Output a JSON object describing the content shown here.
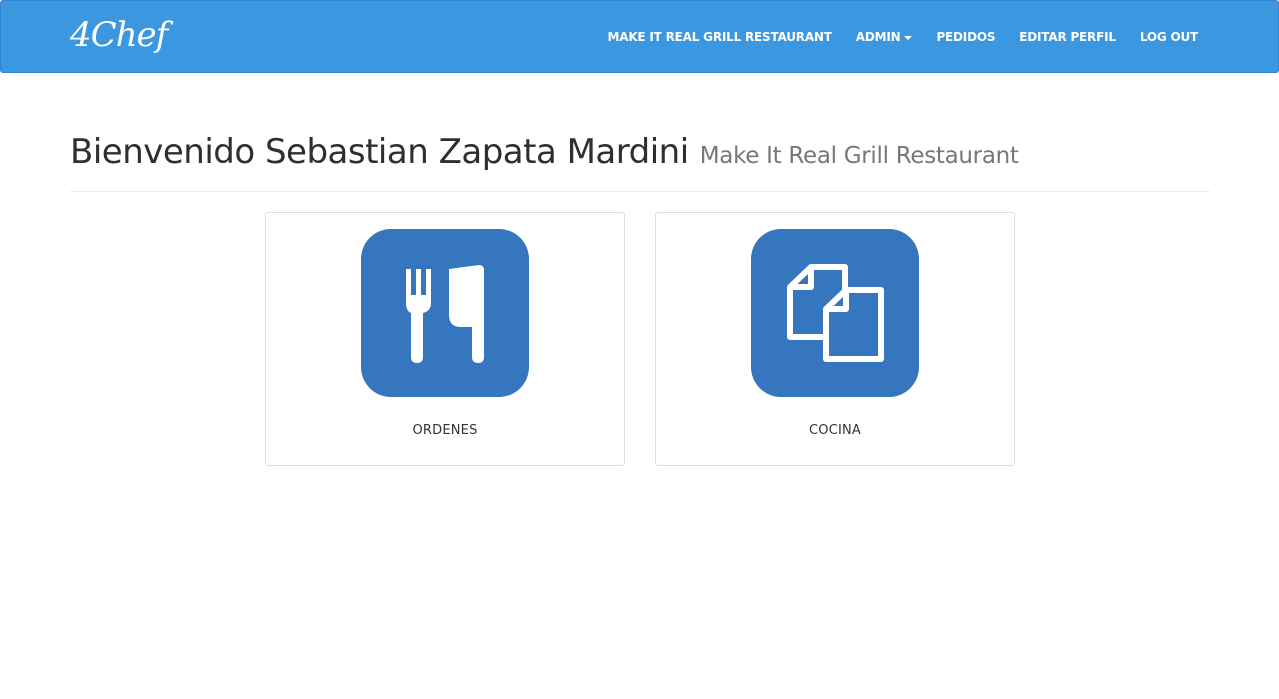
{
  "navbar": {
    "brand": "4Chef",
    "links": [
      {
        "label": "MAKE IT REAL GRILL RESTAURANT"
      },
      {
        "label": "ADMIN",
        "dropdown": true
      },
      {
        "label": "PEDIDOS"
      },
      {
        "label": "EDITAR PERFIL"
      },
      {
        "label": "LOG OUT"
      }
    ]
  },
  "header": {
    "title": "Bienvenido Sebastian Zapata Mardini",
    "subtitle": "Make It Real Grill Restaurant"
  },
  "cards": [
    {
      "label": "ORDENES",
      "icon": "fork-knife-icon"
    },
    {
      "label": "COCINA",
      "icon": "documents-icon"
    }
  ],
  "colors": {
    "navbar": "#3b97df",
    "icon_tile": "#3676bf",
    "title_text": "#2f2f2f",
    "subtitle_text": "#777777"
  }
}
